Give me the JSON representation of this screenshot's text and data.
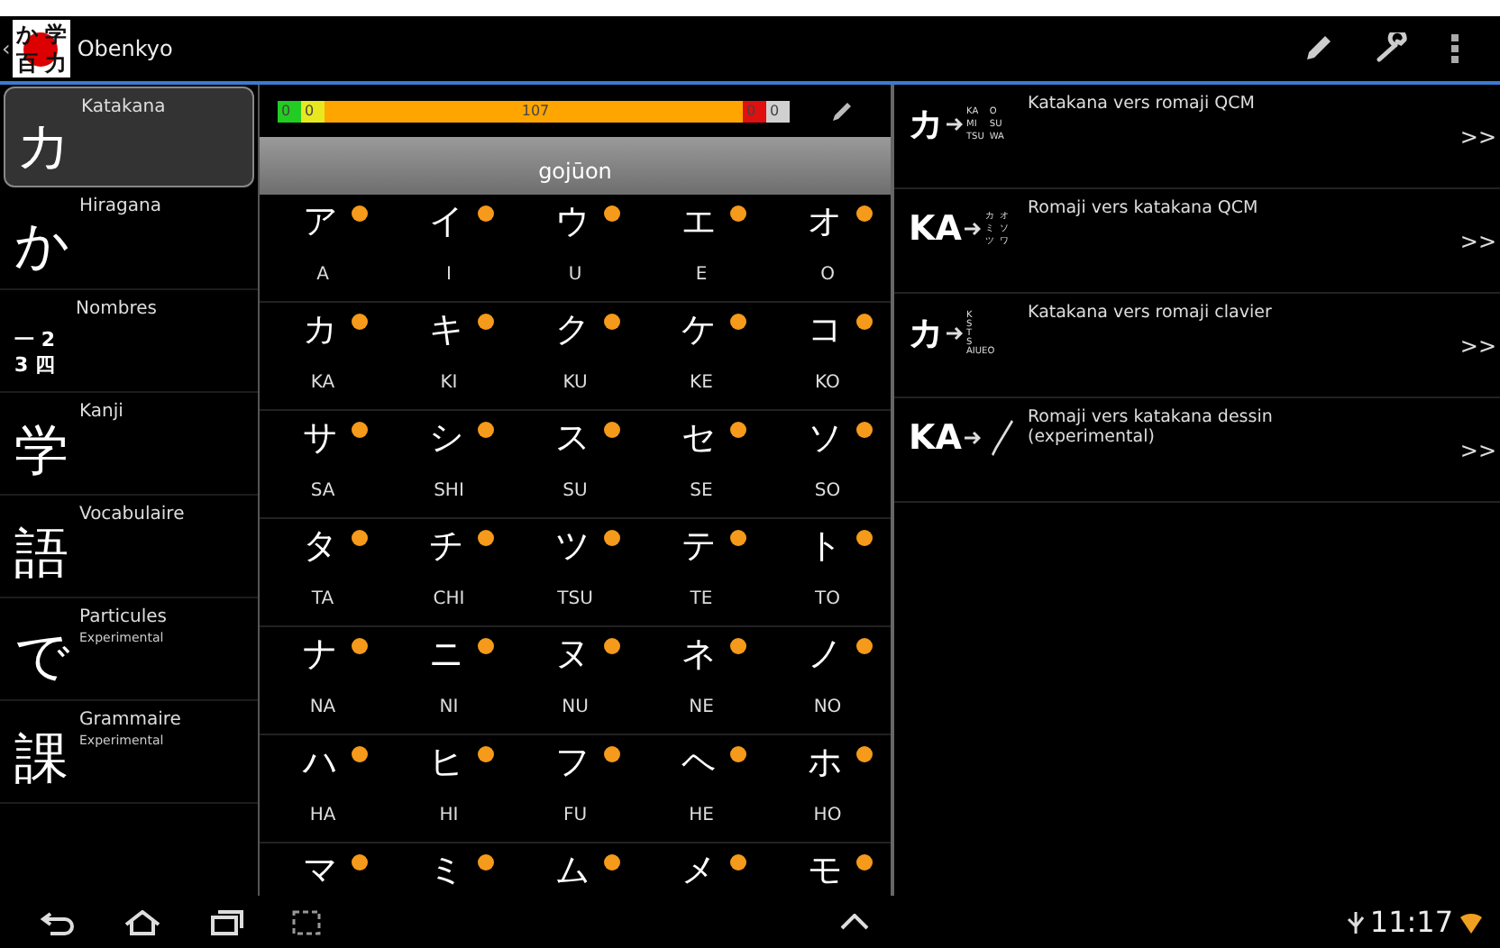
{
  "app_bar": {
    "back": "‹",
    "logo_chars": [
      "か",
      "学",
      "百",
      "力"
    ],
    "title": "Obenkyo"
  },
  "sidebar": {
    "items": [
      {
        "kind": "glyph",
        "glyph": [
          "カ"
        ],
        "label": "Katakana",
        "selected": true
      },
      {
        "kind": "glyph",
        "glyph": [
          "か"
        ],
        "label": "Hiragana",
        "selected": false
      },
      {
        "kind": "stacked",
        "glyph": [
          "一 2",
          "3 四"
        ],
        "label": "Nombres",
        "selected": false
      },
      {
        "kind": "glyph",
        "glyph": [
          "学"
        ],
        "label": "Kanji",
        "selected": false
      },
      {
        "kind": "glyph",
        "glyph": [
          "語"
        ],
        "label": "Vocabulaire",
        "selected": false
      },
      {
        "kind": "glyph",
        "glyph": [
          "で"
        ],
        "label": "Particules",
        "sublabel": "Experimental",
        "selected": false
      },
      {
        "kind": "glyph",
        "glyph": [
          "課"
        ],
        "label": "Grammaire",
        "sublabel": "Experimental",
        "selected": false
      }
    ]
  },
  "progress": {
    "segments": [
      {
        "label": "0",
        "color": "#22cc22"
      },
      {
        "label": "0",
        "color": "#e8e820"
      },
      {
        "label": "107",
        "color": "#ffa500"
      },
      {
        "label": "0",
        "color": "#e01010"
      },
      {
        "label": "0",
        "color": "#d0d0d0"
      }
    ]
  },
  "table": {
    "title": "gojūon",
    "rows": [
      [
        {
          "kana": "ア",
          "romaji": "A"
        },
        {
          "kana": "イ",
          "romaji": "I"
        },
        {
          "kana": "ウ",
          "romaji": "U"
        },
        {
          "kana": "エ",
          "romaji": "E"
        },
        {
          "kana": "オ",
          "romaji": "O"
        }
      ],
      [
        {
          "kana": "カ",
          "romaji": "KA"
        },
        {
          "kana": "キ",
          "romaji": "KI"
        },
        {
          "kana": "ク",
          "romaji": "KU"
        },
        {
          "kana": "ケ",
          "romaji": "KE"
        },
        {
          "kana": "コ",
          "romaji": "KO"
        }
      ],
      [
        {
          "kana": "サ",
          "romaji": "SA"
        },
        {
          "kana": "シ",
          "romaji": "SHI"
        },
        {
          "kana": "ス",
          "romaji": "SU"
        },
        {
          "kana": "セ",
          "romaji": "SE"
        },
        {
          "kana": "ソ",
          "romaji": "SO"
        }
      ],
      [
        {
          "kana": "タ",
          "romaji": "TA"
        },
        {
          "kana": "チ",
          "romaji": "CHI"
        },
        {
          "kana": "ツ",
          "romaji": "TSU"
        },
        {
          "kana": "テ",
          "romaji": "TE"
        },
        {
          "kana": "ト",
          "romaji": "TO"
        }
      ],
      [
        {
          "kana": "ナ",
          "romaji": "NA"
        },
        {
          "kana": "ニ",
          "romaji": "NI"
        },
        {
          "kana": "ヌ",
          "romaji": "NU"
        },
        {
          "kana": "ネ",
          "romaji": "NE"
        },
        {
          "kana": "ノ",
          "romaji": "NO"
        }
      ],
      [
        {
          "kana": "ハ",
          "romaji": "HA"
        },
        {
          "kana": "ヒ",
          "romaji": "HI"
        },
        {
          "kana": "フ",
          "romaji": "FU"
        },
        {
          "kana": "ヘ",
          "romaji": "HE"
        },
        {
          "kana": "ホ",
          "romaji": "HO"
        }
      ],
      [
        {
          "kana": "マ"
        },
        {
          "kana": "ミ"
        },
        {
          "kana": "ム"
        },
        {
          "kana": "メ"
        },
        {
          "kana": "モ"
        }
      ]
    ]
  },
  "exercises": [
    {
      "kind": "choices",
      "source": "カ",
      "targets": [
        "KA",
        "O",
        "MI",
        "SU",
        "TSU",
        "WA"
      ],
      "title": "Katakana vers romaji QCM",
      "go": ">>"
    },
    {
      "kind": "choices",
      "source": "KA",
      "targets": [
        "カ",
        "オ",
        "ミ",
        "ソ",
        "ツ",
        "ワ"
      ],
      "title": "Romaji vers katakana QCM",
      "go": ">>"
    },
    {
      "kind": "keyboard",
      "source": "カ",
      "targets": [
        "K",
        "S",
        "T",
        "S",
        "AIUEO"
      ],
      "title": "Katakana vers romaji clavier",
      "go": ">>"
    },
    {
      "kind": "drawing",
      "source": "KA",
      "title": "Romaji vers katakana dessin\n(experimental)",
      "go": ">>"
    }
  ],
  "status_bar": {
    "time": "11:17"
  }
}
